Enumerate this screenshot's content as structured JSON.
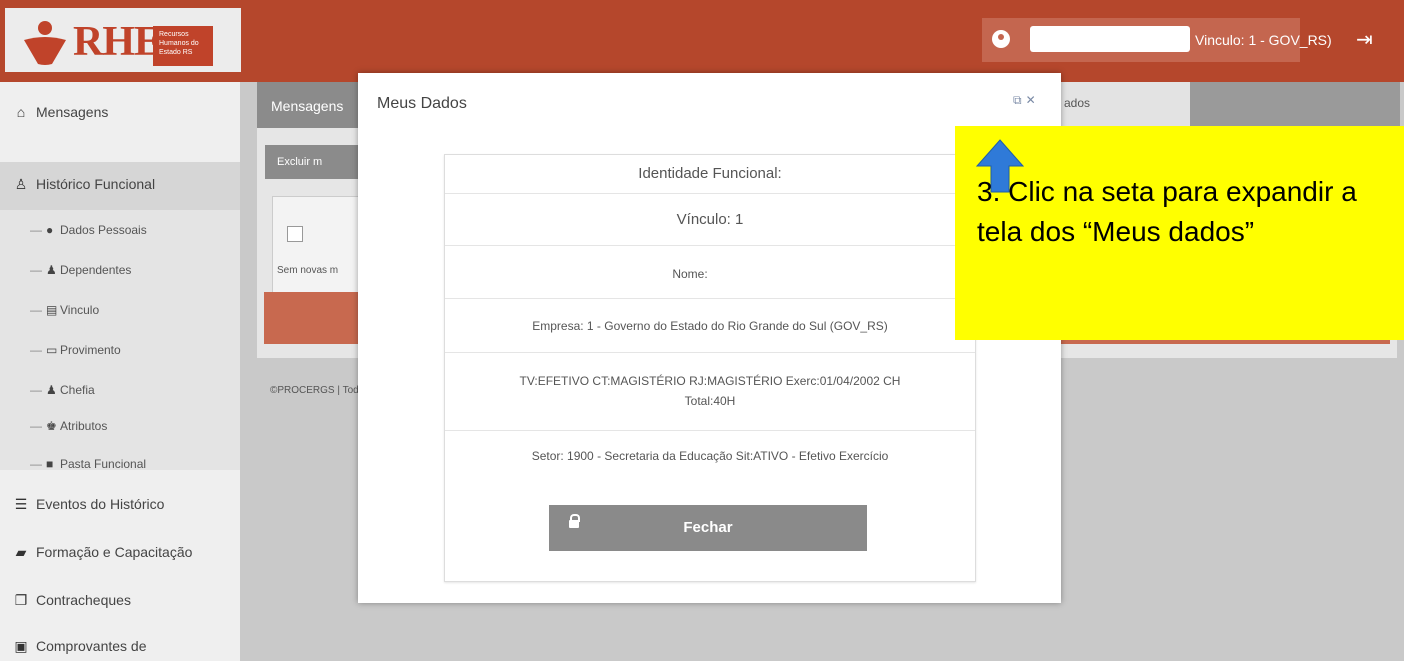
{
  "header": {
    "logo_text": "RHE",
    "logo_subtitle": "Recursos Humanos do Estado RS",
    "user_vinculo": "Vinculo: 1 - GOV_RS)"
  },
  "sidebar": {
    "items": [
      {
        "label": "Mensagens",
        "icon": "home-icon"
      },
      {
        "label": "Histórico Funcional",
        "icon": "user-outline-icon"
      },
      {
        "label": "Eventos do Histórico",
        "icon": "list-icon"
      },
      {
        "label": "Formação e Capacitação",
        "icon": "book-icon"
      },
      {
        "label": "Contracheques",
        "icon": "copy-icon"
      },
      {
        "label": "Comprovantes de",
        "icon": "monitor-icon"
      }
    ],
    "subitems": [
      {
        "label": "Dados Pessoais",
        "icon": "user-icon"
      },
      {
        "label": "Dependentes",
        "icon": "users-icon"
      },
      {
        "label": "Vinculo",
        "icon": "id-card-icon"
      },
      {
        "label": "Provimento",
        "icon": "folder-icon"
      },
      {
        "label": "Chefia",
        "icon": "users-icon"
      },
      {
        "label": "Atributos",
        "icon": "user-tie-icon"
      },
      {
        "label": "Pasta Funcional",
        "icon": "folder-icon"
      }
    ]
  },
  "background": {
    "tab_label": "Mensagens",
    "tab_right_label": "ados",
    "excluir_label": "Excluir m",
    "empty_text": "Sem novas m",
    "footer_text": "©PROCERGS | Tod"
  },
  "modal": {
    "title": "Meus Dados",
    "rows": {
      "identidade": "Identidade Funcional:",
      "vinculo": "Vínculo: 1",
      "nome": "Nome:",
      "empresa": "Empresa: 1 - Governo do Estado do Rio Grande do Sul (GOV_RS)",
      "tipo_line1": "TV:EFETIVO CT:MAGISTÉRIO RJ:MAGISTÉRIO Exerc:01/04/2002 CH",
      "tipo_line2": "Total:40H",
      "setor": "Setor: 1900 - Secretaria da Educação Sit:ATIVO - Efetivo Exercício"
    },
    "close_button": "Fechar"
  },
  "annotation": {
    "text": "3. Clic na seta para expandir a tela dos “Meus dados”",
    "color": "#ffff00"
  },
  "colors": {
    "header": "#b5472c",
    "sidebar": "#efefef",
    "button_gray": "#8a8a8a"
  }
}
